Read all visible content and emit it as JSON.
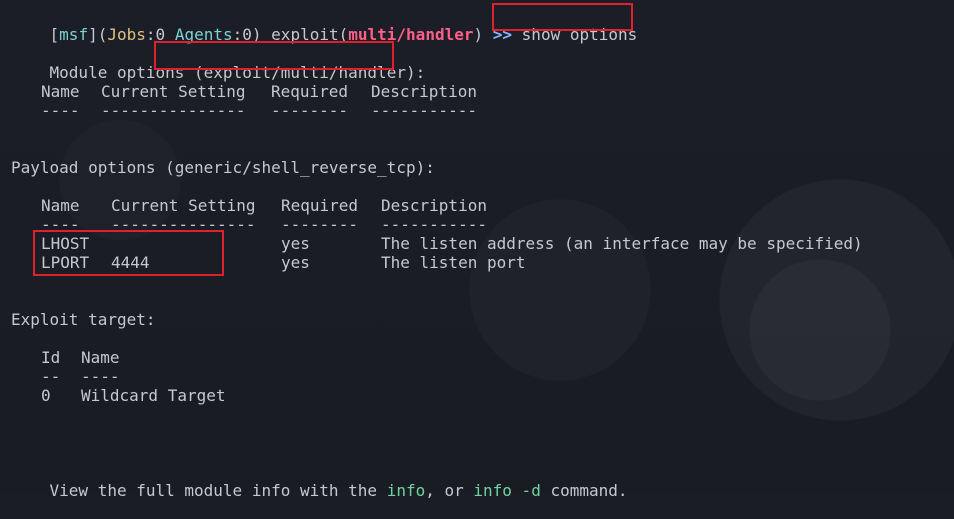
{
  "prompt": {
    "bracket_open": "[",
    "msf": "msf",
    "bracket_close": "]",
    "paren_open": "(",
    "jobs_label": "Jobs",
    "colon1": ":",
    "jobs_count": "0",
    "agents_label": "Agents",
    "colon2": ":",
    "agents_count": "0",
    "paren_close": ")",
    "exploit_word": "exploit",
    "exploit_paren_open": "(",
    "module": "multi/handler",
    "exploit_paren_close": ")",
    "arrow": ">>",
    "command": "show options"
  },
  "module_options": {
    "label": "Module options ",
    "module_path": "(exploit/multi/handler)",
    "colon": ":",
    "headers": {
      "name": "Name",
      "current_setting": "Current Setting",
      "required": "Required",
      "description": "Description"
    },
    "underlines": {
      "name": "----",
      "current_setting": "---------------",
      "required": "--------",
      "description": "-----------"
    }
  },
  "payload_options": {
    "title": "Payload options (generic/shell_reverse_tcp):",
    "headers": {
      "name": "Name",
      "current_setting": "Current Setting",
      "required": "Required",
      "description": "Description"
    },
    "underlines": {
      "name": "----",
      "current_setting": "---------------",
      "required": "--------",
      "description": "-----------"
    },
    "rows": [
      {
        "name": "LHOST",
        "current_setting": "",
        "required": "yes",
        "description": "The listen address (an interface may be specified)"
      },
      {
        "name": "LPORT",
        "current_setting": "4444",
        "required": "yes",
        "description": "The listen port"
      }
    ]
  },
  "exploit_target": {
    "title": "Exploit target:",
    "headers": {
      "id": "Id",
      "name": "Name"
    },
    "underlines": {
      "id": "--",
      "name": "----"
    },
    "rows": [
      {
        "id": "0",
        "name": "Wildcard Target"
      }
    ]
  },
  "footer": {
    "prefix": "View the full module info with the ",
    "info": "info",
    "middle": ", or ",
    "info_d": "info -d",
    "suffix": " command."
  },
  "colors": {
    "background": "#1b1d25",
    "highlight_box": "#e0202c",
    "module_name": "#ff5f87",
    "msf": "#7ad3d0",
    "jobs_label": "#e0c080",
    "agents_label": "#7ad3d0",
    "arrow": "#8ab4ff",
    "command_keyword": "#6fd3a0"
  }
}
